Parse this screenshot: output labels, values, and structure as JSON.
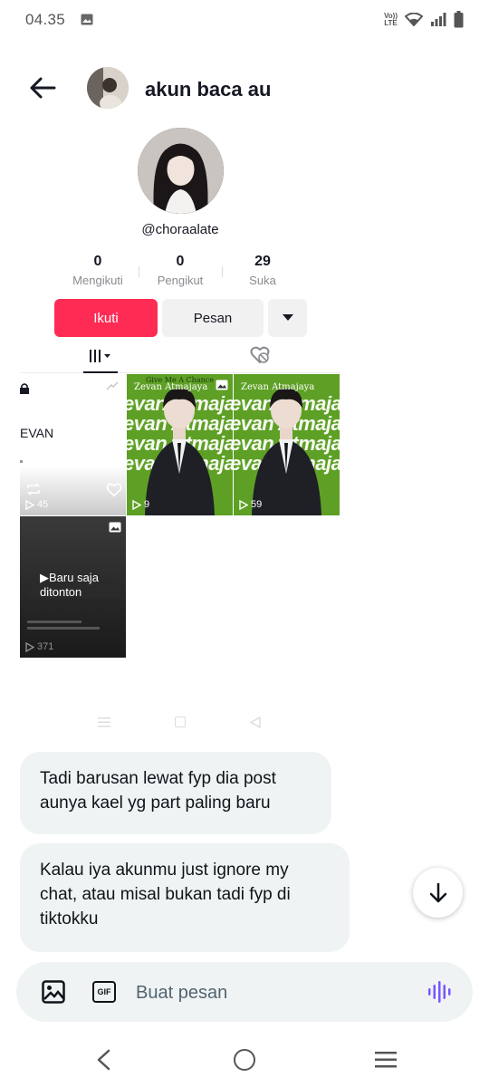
{
  "status_bar": {
    "time": "04.35",
    "volte_top": "Vo))",
    "volte_bottom": "LTE"
  },
  "profile": {
    "header_title": "akun baca au",
    "username": "@choraalate",
    "stats": [
      {
        "value": "0",
        "label": "Mengikuti"
      },
      {
        "value": "0",
        "label": "Pengikut"
      },
      {
        "value": "29",
        "label": "Suka"
      }
    ],
    "follow_label": "Ikuti",
    "message_label": "Pesan"
  },
  "grid": {
    "cell1": {
      "title": "EVAN",
      "views": "45"
    },
    "cell2": {
      "header": "Give Me A Chance",
      "name": "Zevan Atmajaya",
      "bg_text": [
        "evan Atmajaya",
        "evan Atmajay",
        "evan Atmaja",
        "evan Atmajaya"
      ],
      "views": "9"
    },
    "cell3": {
      "name": "Zevan Atmajaya",
      "bg_text": [
        "evan Atmajay",
        "evan Atmajaya",
        "evan Atmaja",
        "evan Atmajay"
      ],
      "views": "59"
    },
    "cell4": {
      "overlay": "Baru saja ditonton",
      "views": "371"
    }
  },
  "messages": [
    {
      "text": "Tadi barusan lewat fyp dia post aunya kael yg part paling baru"
    },
    {
      "text": "Kalau iya akunmu just ignore my chat, atau misal bukan tadi fyp di tiktokku"
    }
  ],
  "composer": {
    "placeholder": "Buat pesan",
    "gif_label": "GIF"
  },
  "colors": {
    "follow": "#fe2c55",
    "green_bg": "#5ea025",
    "voice_accent": "#7856ff",
    "bubble": "#eff3f4"
  }
}
